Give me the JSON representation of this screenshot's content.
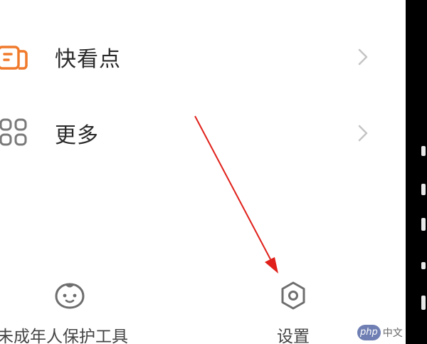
{
  "menu": {
    "items": [
      {
        "label": "快看点",
        "icon": "news-icon"
      },
      {
        "label": "更多",
        "icon": "grid-icon"
      }
    ]
  },
  "bottom_bar": {
    "minor_protection_label": "未成年人保护工具",
    "settings_label": "设置"
  },
  "watermark": {
    "badge": "php",
    "text": "中文"
  },
  "colors": {
    "accent_orange": "#f07a2c",
    "annotation_red": "#e0201a",
    "icon_gray": "#7a7a7a"
  }
}
